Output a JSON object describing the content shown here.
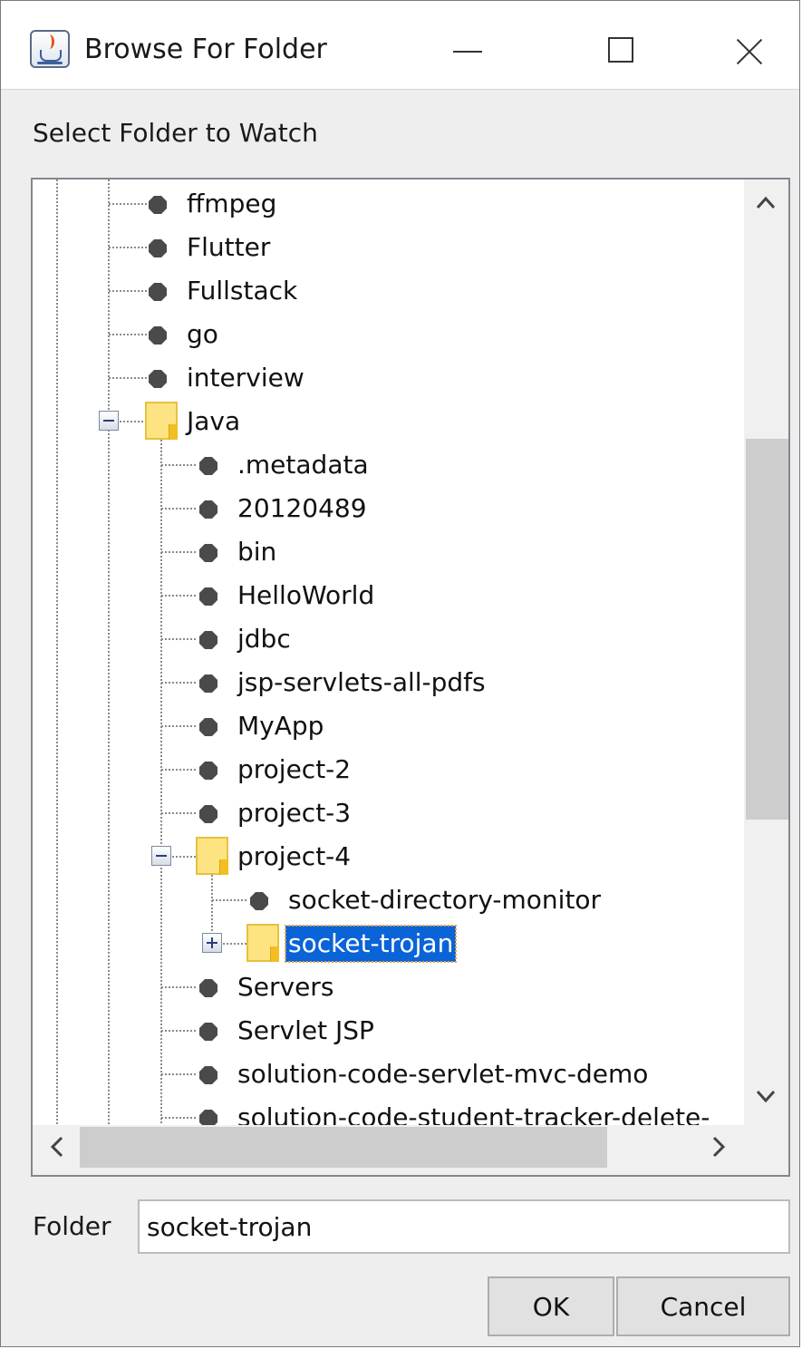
{
  "window": {
    "title": "Browse For Folder",
    "app_icon": "java-coffee-icon"
  },
  "prompt": "Select Folder to Watch",
  "tree": {
    "rows": [
      {
        "label": "ffmpeg",
        "depth": 2,
        "type": "leaf"
      },
      {
        "label": "Flutter",
        "depth": 2,
        "type": "leaf"
      },
      {
        "label": "Fullstack",
        "depth": 2,
        "type": "leaf"
      },
      {
        "label": "go",
        "depth": 2,
        "type": "leaf"
      },
      {
        "label": "interview",
        "depth": 2,
        "type": "leaf"
      },
      {
        "label": "Java",
        "depth": 2,
        "type": "folder",
        "expander": "collapse"
      },
      {
        "label": ".metadata",
        "depth": 3,
        "type": "leaf"
      },
      {
        "label": "20120489",
        "depth": 3,
        "type": "leaf"
      },
      {
        "label": "bin",
        "depth": 3,
        "type": "leaf"
      },
      {
        "label": "HelloWorld",
        "depth": 3,
        "type": "leaf"
      },
      {
        "label": "jdbc",
        "depth": 3,
        "type": "leaf"
      },
      {
        "label": "jsp-servlets-all-pdfs",
        "depth": 3,
        "type": "leaf"
      },
      {
        "label": "MyApp",
        "depth": 3,
        "type": "leaf"
      },
      {
        "label": "project-2",
        "depth": 3,
        "type": "leaf"
      },
      {
        "label": "project-3",
        "depth": 3,
        "type": "leaf"
      },
      {
        "label": "project-4",
        "depth": 3,
        "type": "folder",
        "expander": "collapse"
      },
      {
        "label": "socket-directory-monitor",
        "depth": 4,
        "type": "leaf"
      },
      {
        "label": "socket-trojan",
        "depth": 4,
        "type": "folder",
        "expander": "expand",
        "selected": true
      },
      {
        "label": "Servers",
        "depth": 3,
        "type": "leaf"
      },
      {
        "label": "Servlet JSP",
        "depth": 3,
        "type": "leaf"
      },
      {
        "label": "solution-code-servlet-mvc-demo",
        "depth": 3,
        "type": "leaf"
      },
      {
        "label": "solution-code-student-tracker-delete-",
        "depth": 3,
        "type": "leaf"
      }
    ]
  },
  "folder_field": {
    "label": "Folder",
    "value": "socket-trojan"
  },
  "buttons": {
    "ok": "OK",
    "cancel": "Cancel"
  },
  "colors": {
    "selection": "#0a64d8",
    "folder": "#fde382"
  }
}
